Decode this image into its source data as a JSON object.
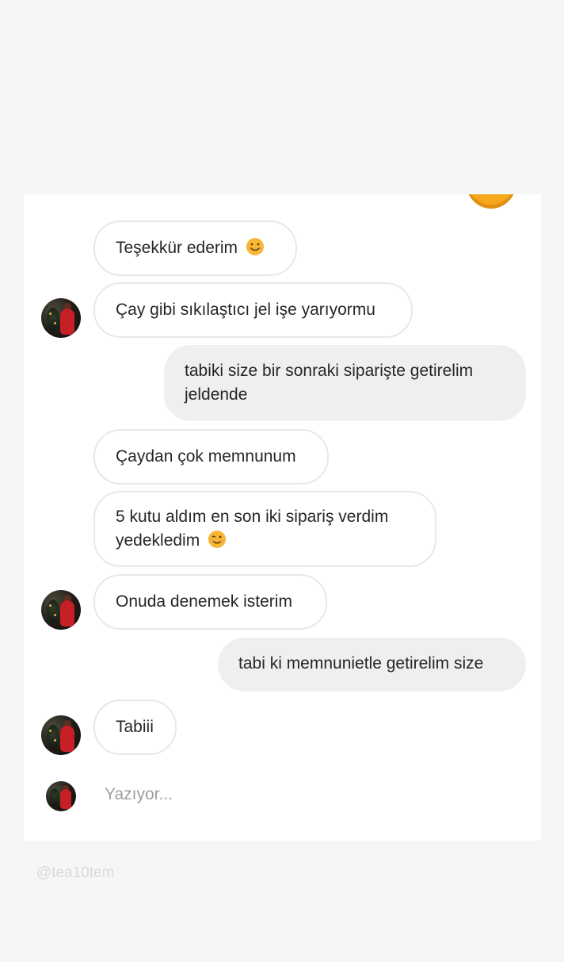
{
  "messages": [
    {
      "id": "m1",
      "direction": "incoming",
      "text": "Teşekkür ederim",
      "emoji": "smiling-face-icon"
    },
    {
      "id": "m2",
      "direction": "incoming",
      "text": "Çay gibi sıkılaştıcı jel işe yarıyormu"
    },
    {
      "id": "m3",
      "direction": "outgoing",
      "lines": [
        "tabiki size bir sonraki siparişte getirelim",
        "jeldende"
      ]
    },
    {
      "id": "m4",
      "direction": "incoming",
      "text": "Çaydan çok memnunum"
    },
    {
      "id": "m5",
      "direction": "incoming",
      "lines": [
        "5 kutu aldım en son iki sipariş verdim",
        "yedekledim"
      ],
      "emoji": "winking-face-icon"
    },
    {
      "id": "m6",
      "direction": "incoming",
      "text": "Onuda denemek isterim"
    },
    {
      "id": "m7",
      "direction": "outgoing",
      "text": "tabi ki memnunietle getirelim size"
    },
    {
      "id": "m8",
      "direction": "incoming",
      "text": "Tabiii"
    }
  ],
  "typing_indicator": "Yazıyor...",
  "watermark": "@tea10tem",
  "colors": {
    "incoming_bubble_border": "#e8e8e8",
    "outgoing_bubble_bg": "#efefef",
    "text": "#262626",
    "typing_text": "#9f9f9f",
    "emoji_yellow": "#f6a81c"
  }
}
